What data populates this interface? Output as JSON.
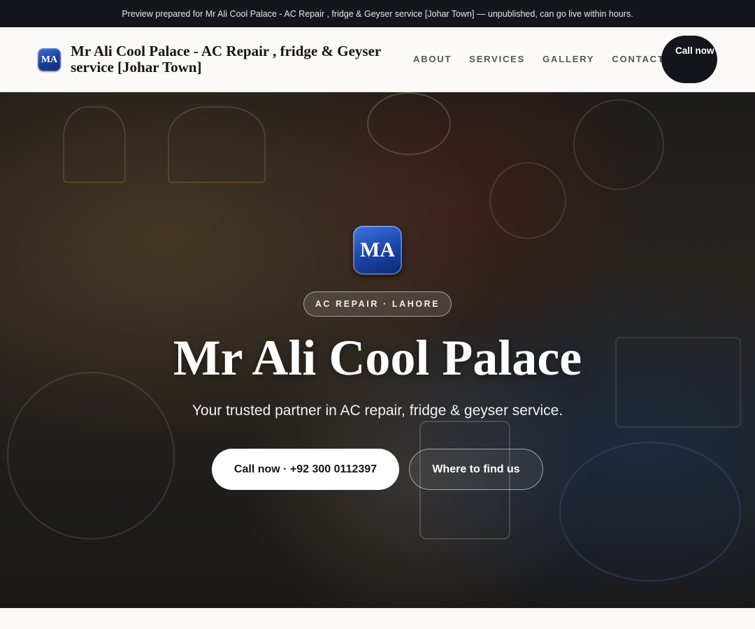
{
  "banner": {
    "text": "Preview prepared for Mr Ali Cool Palace - AC Repair , fridge & Geyser service [Johar Town] — unpublished, can go live within hours."
  },
  "header": {
    "logo_initials": "MA",
    "brand_name": "Mr Ali Cool Palace - AC Repair , fridge & Geyser service [Johar Town]",
    "nav": [
      "ABOUT",
      "SERVICES",
      "GALLERY",
      "CONTACT"
    ],
    "call_label": "Call now"
  },
  "hero": {
    "logo_initials": "MA",
    "eyebrow": "AC REPAIR · LAHORE",
    "title": "Mr Ali Cool Palace",
    "subtitle": "Your trusted partner in AC repair, fridge & geyser service.",
    "primary_cta": "Call now · +92 300 0112397",
    "secondary_cta": "Where to find us",
    "background_image": "shop-interior-photo"
  },
  "colors": {
    "dark": "#14161b",
    "logo_blue": "#1b43a4",
    "light_bg": "#faf9f7"
  }
}
